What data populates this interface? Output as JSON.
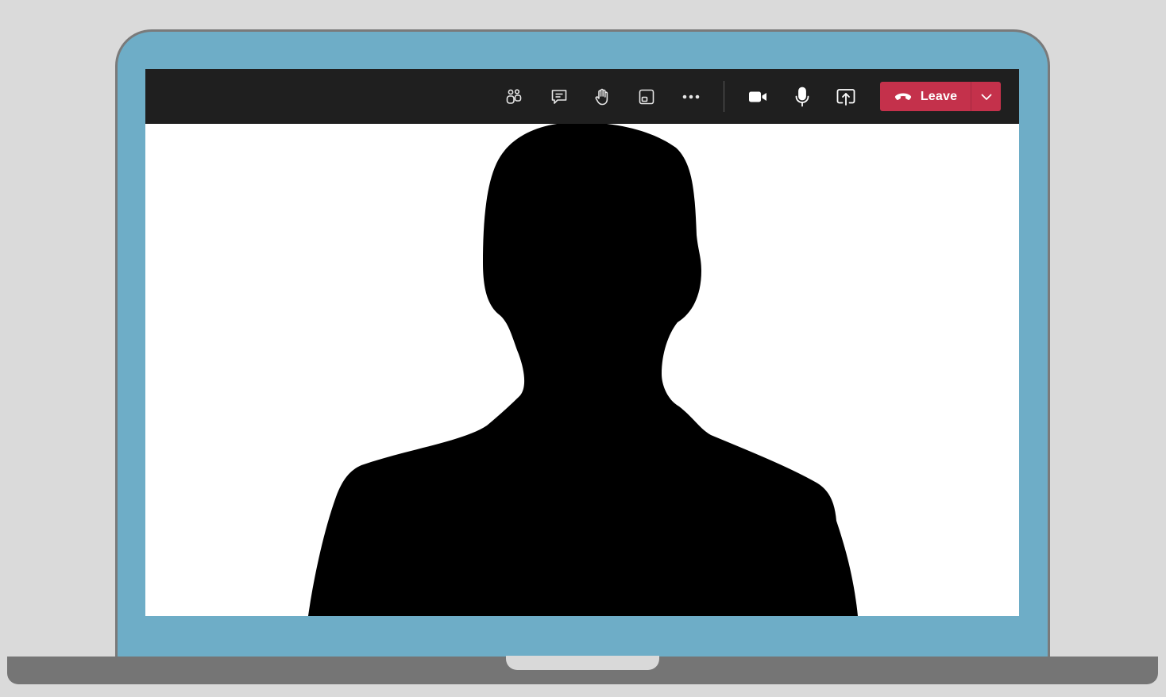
{
  "toolbar": {
    "buttons": [
      {
        "icon": "people-icon"
      },
      {
        "icon": "chat-icon"
      },
      {
        "icon": "raise-hand-icon"
      },
      {
        "icon": "share-tray-icon"
      },
      {
        "icon": "more-options-icon"
      },
      {
        "icon": "camera-icon"
      },
      {
        "icon": "microphone-icon"
      },
      {
        "icon": "share-screen-icon"
      }
    ],
    "leave": {
      "label": "Leave",
      "icon": "hang-up-icon",
      "dropdown_icon": "chevron-down-icon"
    }
  },
  "colors": {
    "toolbar_bg": "#1f1f1f",
    "leave_red": "#c4314b",
    "lid_blue": "#6eadc7",
    "laptop_gray": "#757575",
    "background": "#dadada"
  }
}
